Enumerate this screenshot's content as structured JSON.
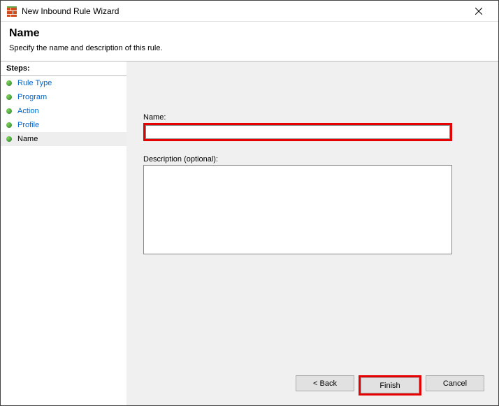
{
  "titlebar": {
    "title": "New Inbound Rule Wizard"
  },
  "header": {
    "title": "Name",
    "subtitle": "Specify the name and description of this rule."
  },
  "sidebar": {
    "steps_label": "Steps:",
    "items": [
      {
        "label": "Rule Type"
      },
      {
        "label": "Program"
      },
      {
        "label": "Action"
      },
      {
        "label": "Profile"
      },
      {
        "label": "Name"
      }
    ]
  },
  "form": {
    "name_label": "Name:",
    "name_value": "",
    "desc_label": "Description (optional):",
    "desc_value": ""
  },
  "buttons": {
    "back": "< Back",
    "finish": "Finish",
    "cancel": "Cancel"
  }
}
